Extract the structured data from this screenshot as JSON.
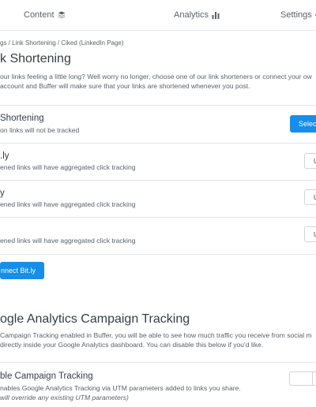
{
  "nav": {
    "tabs": [
      {
        "label": "Content",
        "icon": "layers-icon"
      },
      {
        "label": "Analytics",
        "icon": "bar-chart-icon"
      },
      {
        "label": "Settings",
        "icon": "gear-icon"
      }
    ]
  },
  "breadcrumb": "gs / Link Shortening / Ciked (LinkedIn Page)",
  "link_shortening": {
    "title": "k Shortening",
    "description_lines": [
      "our links feeling a little long? Well worry no longer, choose one of our link shorteners or connect your ow",
      "account and Buffer will make sure that your links are shortened whenever you post."
    ],
    "options": [
      {
        "title": "Shortening",
        "description": "on links will not be tracked",
        "button": "Selec"
      },
      {
        "title": ".ly",
        "description": "ened links will have aggregated click tracking",
        "button": "U"
      },
      {
        "title": "y",
        "description": "ened links will have aggregated click tracking",
        "button": "U"
      },
      {
        "title": "",
        "description": "ened links will have aggregated click tracking",
        "button": "U"
      }
    ],
    "connect_button": "nnect Bit.ly"
  },
  "campaign_tracking": {
    "title": "ogle Analytics Campaign Tracking",
    "description_lines": [
      "Campaign Tracking enabled in Buffer, you will be able to see how much traffic you receive from social m",
      "directly inside your Google Analytics dashboard. You can disable this below if you'd like."
    ],
    "option": {
      "title": "ble Campaign Tracking",
      "description": "nables Google Analytics Tracking via UTM parameters added to links you share.",
      "note": "will override any existing UTM parameters)"
    }
  },
  "colors": {
    "accent": "#168eea",
    "text": "#343e47",
    "muted": "#59626a",
    "border": "#e3e5e8"
  }
}
